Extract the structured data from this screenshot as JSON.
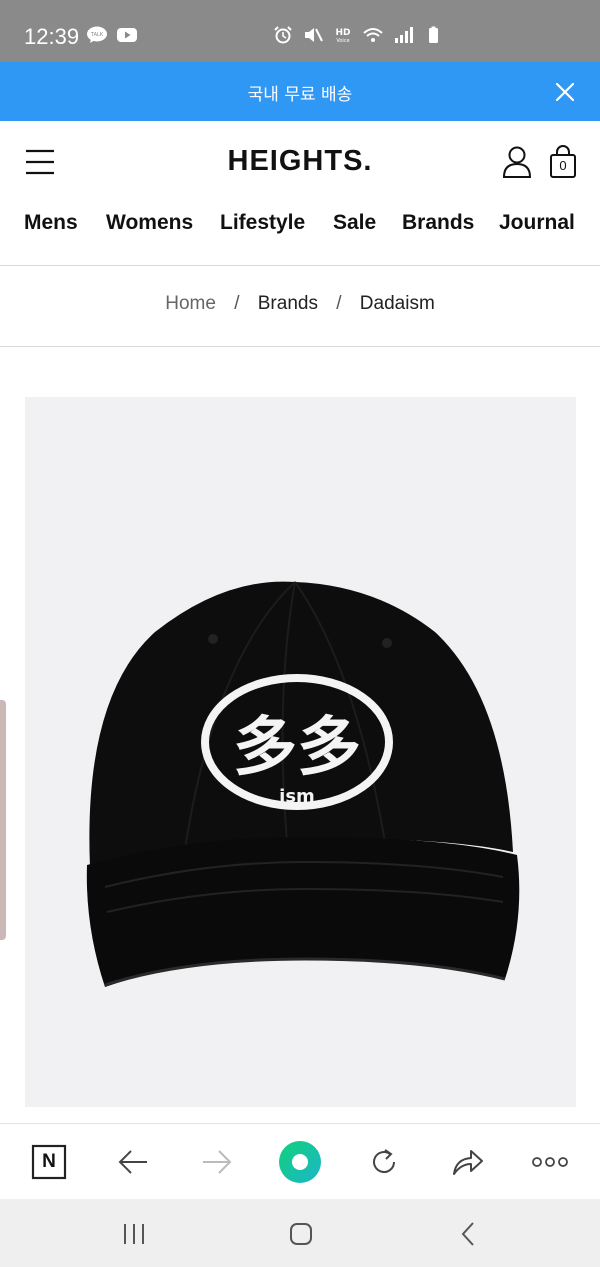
{
  "status_bar": {
    "time": "12:39"
  },
  "promo": {
    "text": "국내 무료 배송"
  },
  "header": {
    "logo": "HEIGHTS.",
    "bag_count": "0",
    "nav": [
      "Mens",
      "Womens",
      "Lifestyle",
      "Sale",
      "Brands",
      "Journal"
    ]
  },
  "breadcrumb": {
    "home": "Home",
    "sep1": "/",
    "brands": "Brands",
    "sep2": "/",
    "current": "Dadaism"
  },
  "product": {
    "logo_chars": "多多",
    "logo_sub": "ism"
  },
  "browser_bar": {
    "n_label": "N"
  },
  "colors": {
    "promo": "#2f97f4",
    "status_bar": "#8a8a8a",
    "accent_green": "#18c98b"
  }
}
